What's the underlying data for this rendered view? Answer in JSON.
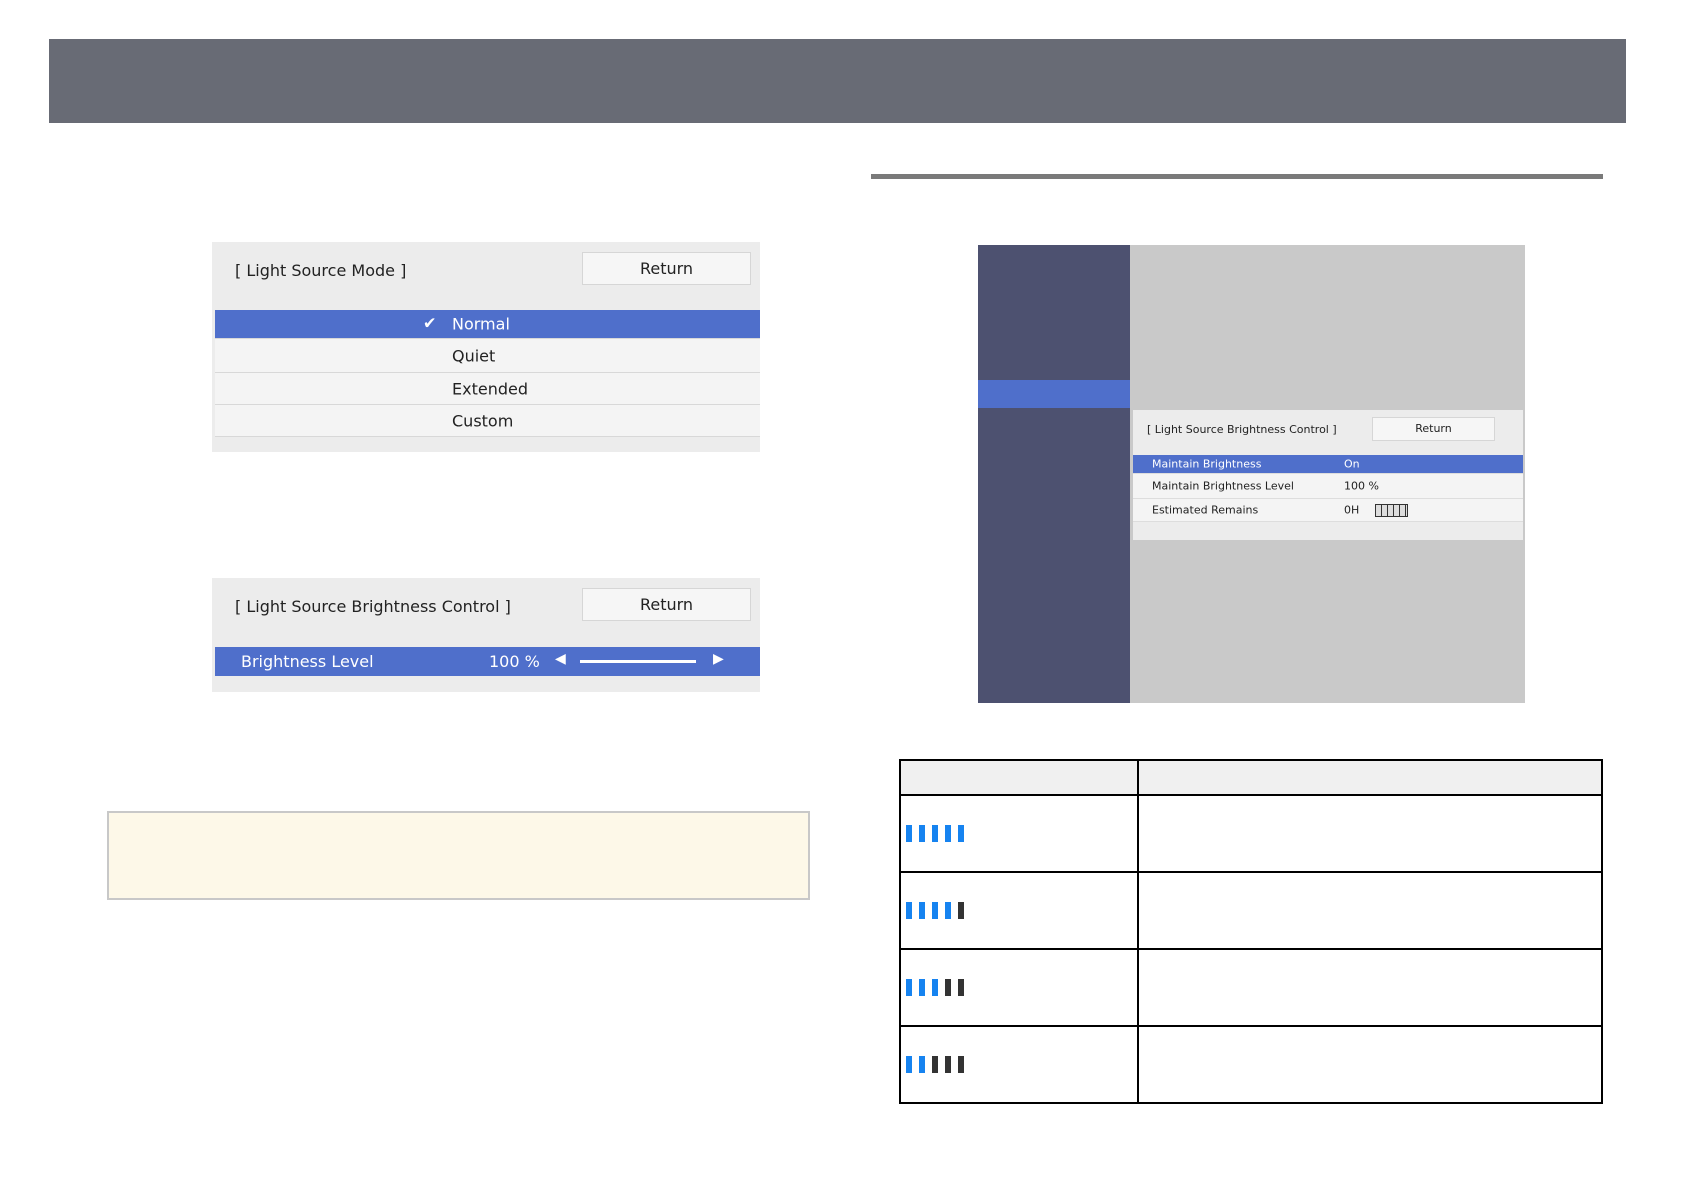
{
  "panel_mode": {
    "title": "[ Light Source Mode ]",
    "return_label": "Return",
    "options": [
      "Normal",
      "Quiet",
      "Extended",
      "Custom"
    ],
    "selected": "Normal"
  },
  "panel_brightness": {
    "title": "[ Light Source Brightness Control ]",
    "return_label": "Return",
    "row_label": "Brightness Level",
    "row_value": "100 %",
    "level_percent": 100
  },
  "screenshot": {
    "title": "[ Light Source Brightness Control ]",
    "return_label": "Return",
    "rows": [
      {
        "label": "Maintain Brightness",
        "value": "On"
      },
      {
        "label": "Maintain Brightness Level",
        "value": "100 %"
      },
      {
        "label": "Estimated Remains",
        "value": "0H"
      }
    ]
  },
  "table": {
    "rows": [
      {
        "lit": 5
      },
      {
        "lit": 4
      },
      {
        "lit": 3
      },
      {
        "lit": 2
      }
    ]
  },
  "colors": {
    "header": "#686b75",
    "accent": "#4f6fcb",
    "bar_lit": "#1683f0",
    "bar_off": "#333333",
    "note_bg": "#fdf8e8"
  }
}
